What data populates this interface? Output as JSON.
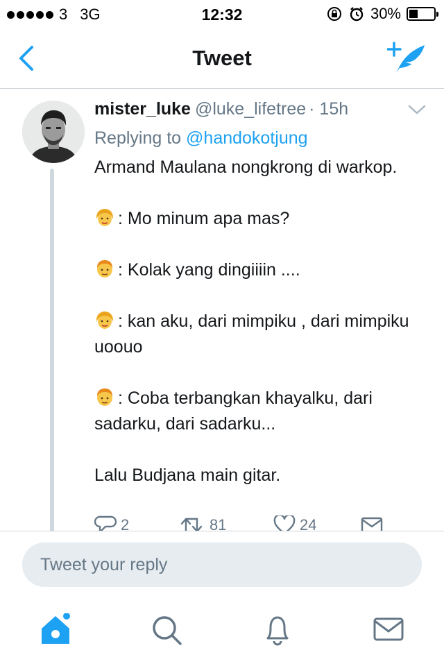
{
  "status_bar": {
    "carrier": "3",
    "network": "3G",
    "time": "12:32",
    "battery": "30%"
  },
  "nav": {
    "title": "Tweet",
    "back_icon": "chevron-left-icon",
    "compose_icon": "compose-tweet-icon"
  },
  "tweet": {
    "display_name": "mister_luke",
    "handle": "@luke_lifetree",
    "time": "· 15h",
    "replying_label": "Replying to",
    "replying_to": "@handokotjung",
    "lines": [
      {
        "text": "Armand Maulana nongkrong di warkop.",
        "emoji": ""
      },
      {
        "text": ": Mo minum apa mas?",
        "emoji": "woman-face"
      },
      {
        "text": ": Kolak yang dingiiiin ....",
        "emoji": "man-face"
      },
      {
        "text": ": kan aku, dari mimpiku , dari mimpiku uoouo",
        "emoji": "woman-face"
      },
      {
        "text": ": Coba terbangkan khayalku, dari sadarku, dari sadarku...",
        "emoji": "man-face"
      },
      {
        "text": "Lalu Budjana main gitar.",
        "emoji": ""
      }
    ],
    "actions": {
      "replies": "2",
      "retweets": "81",
      "likes": "24"
    }
  },
  "reply_box": {
    "placeholder": "Tweet your reply"
  },
  "tab_bar": {
    "items": [
      "home-icon",
      "search-icon",
      "notifications-icon",
      "messages-icon"
    ]
  },
  "colors": {
    "accent": "#1da1f2",
    "text": "#14171a",
    "secondary": "#657786"
  }
}
